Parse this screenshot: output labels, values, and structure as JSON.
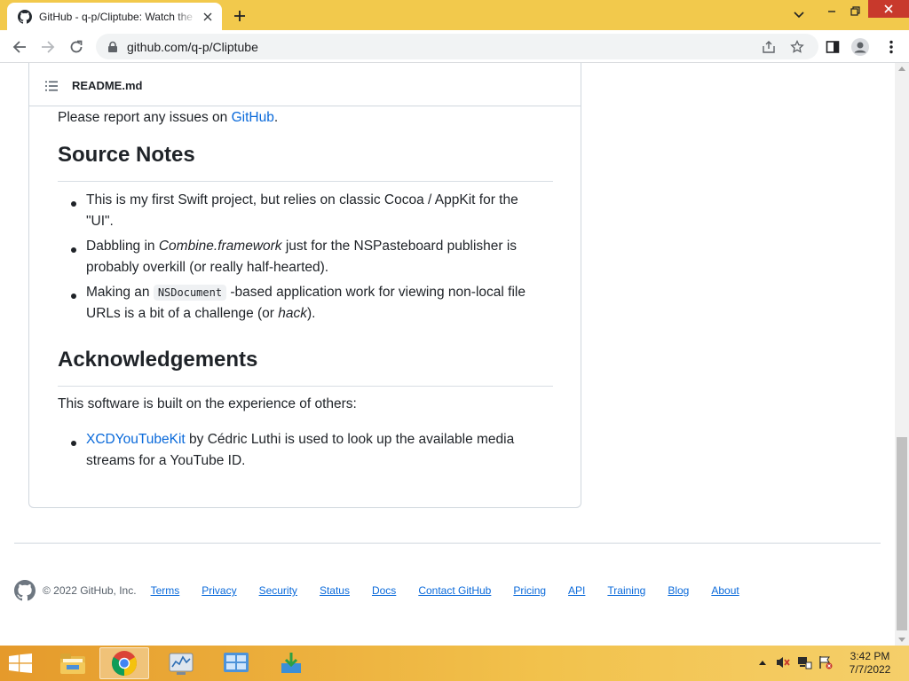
{
  "browser": {
    "tab_title": "GitHub - q-p/Cliptube: Watch the",
    "url": "github.com/q-p/Cliptube"
  },
  "readme": {
    "filename": "README.md",
    "report_text": "Please report any issues on ",
    "report_link": "GitHub",
    "report_end": ".",
    "source_notes": {
      "heading": "Source Notes",
      "item1_line1": "This is my first Swift project, but relies on classic Cocoa / AppKit for the",
      "item1_line2": "\"UI\".",
      "item2_pre": "Dabbling in ",
      "item2_em": "Combine.framework",
      "item2_post": " just for the NSPasteboard publisher is",
      "item2_line2": "probably overkill (or really half-hearted).",
      "item3_pre": "Making an ",
      "item3_code": "NSDocument",
      "item3_post": " -based application work for viewing non-local file",
      "item3_line2_pre": "URLs is a bit of a challenge (or ",
      "item3_line2_em": "hack",
      "item3_line2_post": ")."
    },
    "acknowledgements": {
      "heading": "Acknowledgements",
      "intro": "This software is built on the experience of others:",
      "item_link": "XCDYouTubeKit",
      "item_post": " by Cédric Luthi is used to look up the available media",
      "item_line2": "streams for a YouTube ID."
    }
  },
  "footer": {
    "copyright": "© 2022 GitHub, Inc.",
    "links": [
      "Terms",
      "Privacy",
      "Security",
      "Status",
      "Docs",
      "Contact GitHub",
      "Pricing",
      "API",
      "Training",
      "Blog",
      "About"
    ]
  },
  "taskbar": {
    "time": "3:42 PM",
    "date": "7/7/2022"
  },
  "colors": {
    "link": "#0969da",
    "tabbar": "#f2c94c",
    "close_button": "#c8392c"
  }
}
